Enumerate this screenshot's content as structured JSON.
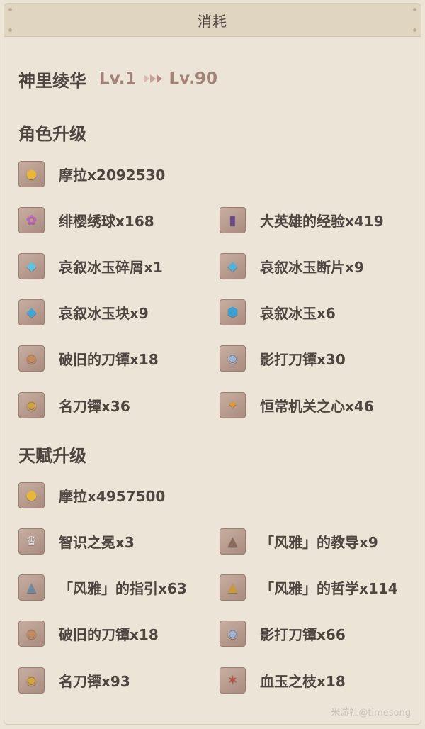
{
  "header": {
    "title": "消耗"
  },
  "character": {
    "name": "神里绫华",
    "level_from": "Lv.1",
    "level_to": "Lv.90"
  },
  "sections": {
    "ascension": {
      "title": "角色升级",
      "items": [
        {
          "label": "摩拉x2092530",
          "icon": "mora-coin-icon",
          "glyph": "●",
          "tint": "#e8b73a"
        },
        {
          "label": "绯樱绣球x168",
          "icon": "sakura-bloom-icon",
          "glyph": "✿",
          "tint": "#c060c0"
        },
        {
          "label": "大英雄的经验x419",
          "icon": "heros-wit-book-icon",
          "glyph": "▮",
          "tint": "#6a4a8a"
        },
        {
          "label": "哀叙冰玉碎屑x1",
          "icon": "shivada-jade-sliver-icon",
          "glyph": "◆",
          "tint": "#5fc3e6"
        },
        {
          "label": "哀叙冰玉断片x9",
          "icon": "shivada-jade-fragment-icon",
          "glyph": "◆",
          "tint": "#4db3dd"
        },
        {
          "label": "哀叙冰玉块x9",
          "icon": "shivada-jade-chunk-icon",
          "glyph": "◆",
          "tint": "#3ea7d8"
        },
        {
          "label": "哀叙冰玉x6",
          "icon": "shivada-jade-gemstone-icon",
          "glyph": "⬢",
          "tint": "#3a9fd4"
        },
        {
          "label": "破旧的刀镡x18",
          "icon": "old-handguard-icon",
          "glyph": "◉",
          "tint": "#c88a5a"
        },
        {
          "label": "影打刀镡x30",
          "icon": "kageuchi-handguard-icon",
          "glyph": "◉",
          "tint": "#9fb5d6"
        },
        {
          "label": "名刀镡x36",
          "icon": "famous-handguard-icon",
          "glyph": "◉",
          "tint": "#d4a43c"
        },
        {
          "label": "恒常机关之心x46",
          "icon": "perpetual-heart-icon",
          "glyph": "✦",
          "tint": "#e09a2a"
        }
      ]
    },
    "talents": {
      "title": "天赋升级",
      "items": [
        {
          "label": "摩拉x4957500",
          "icon": "mora-coin-icon",
          "glyph": "●",
          "tint": "#e8b73a"
        },
        {
          "label": "智识之冕x3",
          "icon": "crown-of-insight-icon",
          "glyph": "♛",
          "tint": "#e0e0e0"
        },
        {
          "label": "「风雅」的教导x9",
          "icon": "teachings-of-elegance-icon",
          "glyph": "▲",
          "tint": "#8a6a5a"
        },
        {
          "label": "「风雅」的指引x63",
          "icon": "guide-to-elegance-icon",
          "glyph": "▲",
          "tint": "#6f8aa0"
        },
        {
          "label": "「风雅」的哲学x114",
          "icon": "philosophies-of-elegance-icon",
          "glyph": "▲",
          "tint": "#c99a3a"
        },
        {
          "label": "破旧的刀镡x18",
          "icon": "old-handguard-icon",
          "glyph": "◉",
          "tint": "#c88a5a"
        },
        {
          "label": "影打刀镡x66",
          "icon": "kageuchi-handguard-icon",
          "glyph": "◉",
          "tint": "#9fb5d6"
        },
        {
          "label": "名刀镡x93",
          "icon": "famous-handguard-icon",
          "glyph": "◉",
          "tint": "#d4a43c"
        },
        {
          "label": "血玉之枝x18",
          "icon": "bloodjade-branch-icon",
          "glyph": "✶",
          "tint": "#c04a3a"
        }
      ]
    }
  },
  "watermark": "米游社@timesong"
}
